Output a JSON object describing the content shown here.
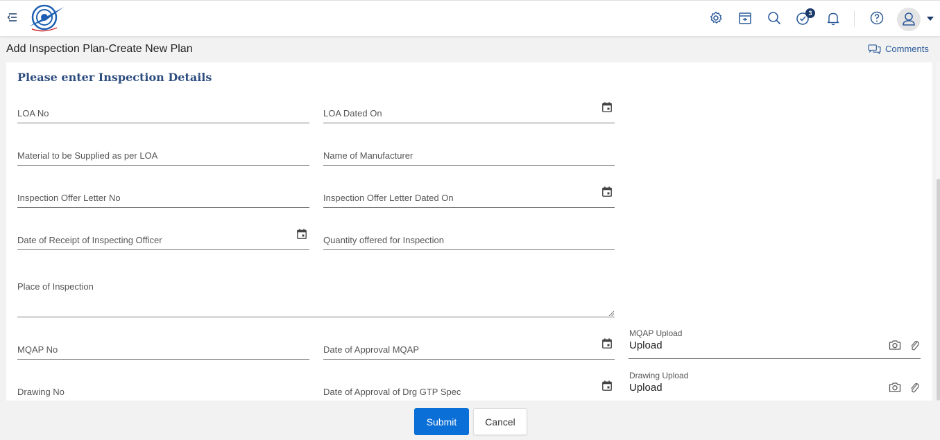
{
  "header": {
    "icons": [
      "menu-toggle-icon",
      "logo",
      "settings-icon",
      "store-icon",
      "search-icon",
      "tasks-icon",
      "bell-icon",
      "help-icon",
      "user-icon",
      "caret-down-icon"
    ],
    "tasks_badge": "3"
  },
  "page": {
    "title": "Add Inspection Plan-Create New Plan",
    "comments_label": "Comments"
  },
  "form": {
    "section_title": "Please enter Inspection Details",
    "fields": {
      "loa_no": "LOA No",
      "loa_dated_on": "LOA Dated On",
      "material": "Material to be Supplied as per LOA",
      "manufacturer": "Name of Manufacturer",
      "offer_letter_no": "Inspection Offer Letter No",
      "offer_letter_dated": "Inspection Offer Letter Dated On",
      "receipt_date": "Date of Receipt of Inspecting Officer",
      "quantity": "Quantity offered for Inspection",
      "place": "Place of Inspection",
      "mqap_no": "MQAP No",
      "mqap_approval": "Date of Approval MQAP",
      "drawing_no": "Drawing No",
      "drg_approval": "Date of Approval of Drg GTP Spec"
    },
    "uploads": {
      "mqap_label": "MQAP Upload",
      "mqap_value": "Upload",
      "drawing_label": "Drawing Upload",
      "drawing_value": "Upload"
    }
  },
  "actions": {
    "submit": "Submit",
    "cancel": "Cancel"
  },
  "colors": {
    "accent": "#0a6fd6",
    "title_blue": "#2e4d7f",
    "badge": "#1a3a6b"
  }
}
